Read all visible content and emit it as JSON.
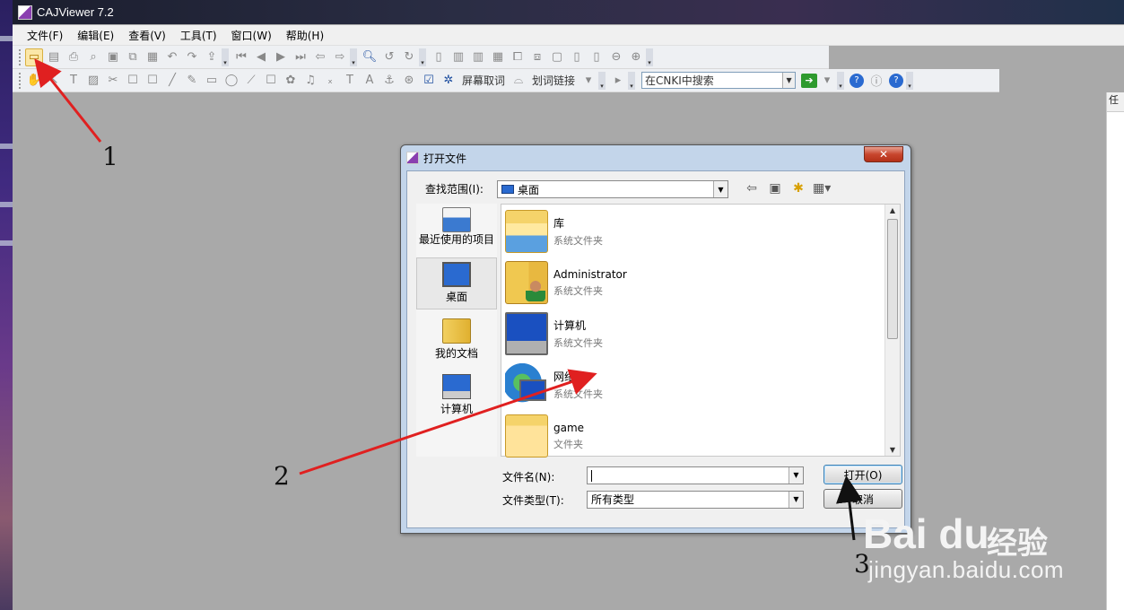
{
  "app": {
    "title": "CAJViewer 7.2",
    "menu": [
      "文件(F)",
      "编辑(E)",
      "查看(V)",
      "工具(T)",
      "窗口(W)",
      "帮助(H)"
    ],
    "toolbar2": {
      "screen_word": "屏幕取词",
      "word_link": "划词链接",
      "search_placeholder": "在CNKI中搜索"
    },
    "right_panel_char": "任"
  },
  "dialog": {
    "title": "打开文件",
    "look_in_label": "查找范围(I):",
    "look_in_value": "桌面",
    "places": [
      {
        "label": "最近使用的项目",
        "icon": "recent-places-icon"
      },
      {
        "label": "桌面",
        "icon": "desktop-icon",
        "selected": true
      },
      {
        "label": "我的文档",
        "icon": "my-documents-icon"
      },
      {
        "label": "计算机",
        "icon": "computer-icon"
      }
    ],
    "files": [
      {
        "name": "库",
        "type": "系统文件夹",
        "icon": "library-icon"
      },
      {
        "name": "Administrator",
        "type": "系统文件夹",
        "icon": "user-folder-icon"
      },
      {
        "name": "计算机",
        "type": "系统文件夹",
        "icon": "computer-icon"
      },
      {
        "name": "网络",
        "type": "系统文件夹",
        "icon": "network-icon"
      },
      {
        "name": "game",
        "type": "文件夹",
        "icon": "folder-icon"
      }
    ],
    "filename_label": "文件名(N):",
    "filename_value": "",
    "filetype_label": "文件类型(T):",
    "filetype_value": "所有类型",
    "open_button": "打开(O)",
    "cancel_button": "取消",
    "close_glyph": "✕"
  },
  "annotations": {
    "labels": [
      "1",
      "2",
      "3"
    ],
    "arrow_color": "#e02020"
  },
  "watermark": {
    "logo": "Bai du",
    "cn": "经验",
    "url": "jingyan.baidu.com"
  }
}
